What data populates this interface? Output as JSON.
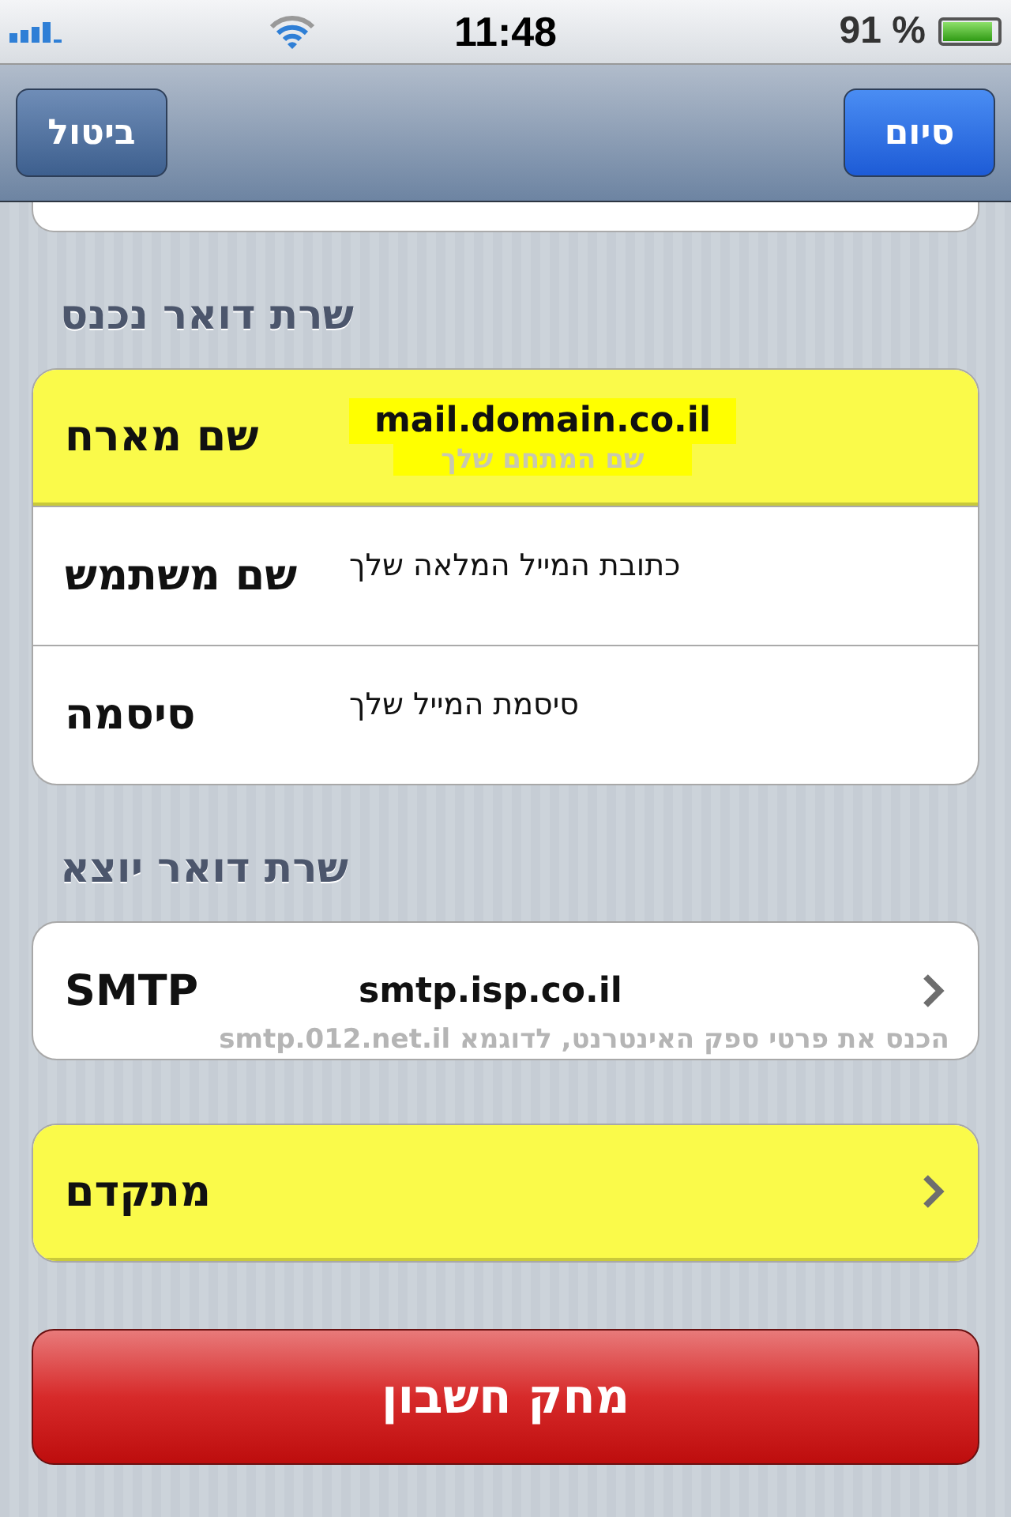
{
  "status_bar": {
    "time": "11:48",
    "battery": "91 %"
  },
  "nav": {
    "cancel": "ביטול",
    "done": "סיום"
  },
  "sections": [
    {
      "header": "שרת דואר נכנס",
      "rows": [
        {
          "label": "שם מארח",
          "kind": "host",
          "value": "mail.domain.co.il",
          "note": "שם המתחם שלך",
          "highlighted": true,
          "chevron": false
        },
        {
          "label": "שם משתמש",
          "kind": "hint",
          "value": "כתובת המייל המלאה שלך",
          "highlighted": false,
          "chevron": false
        },
        {
          "label": "סיסמה",
          "kind": "hint",
          "value": "סיסמת המייל שלך",
          "highlighted": false,
          "chevron": false
        }
      ]
    },
    {
      "header": "שרת דואר יוצא",
      "rows": [
        {
          "label": "SMTP",
          "kind": "host",
          "value": "smtp.isp.co.il",
          "note": "הכנס את פרטי ספק האינטרנט, לדוגמא smtp.012.net.il",
          "highlighted": false,
          "chevron": true
        }
      ]
    },
    {
      "rows": [
        {
          "label": "מתקדם",
          "kind": "plain",
          "highlighted": true,
          "chevron": true
        }
      ]
    }
  ],
  "delete_button": "מחק חשבון"
}
